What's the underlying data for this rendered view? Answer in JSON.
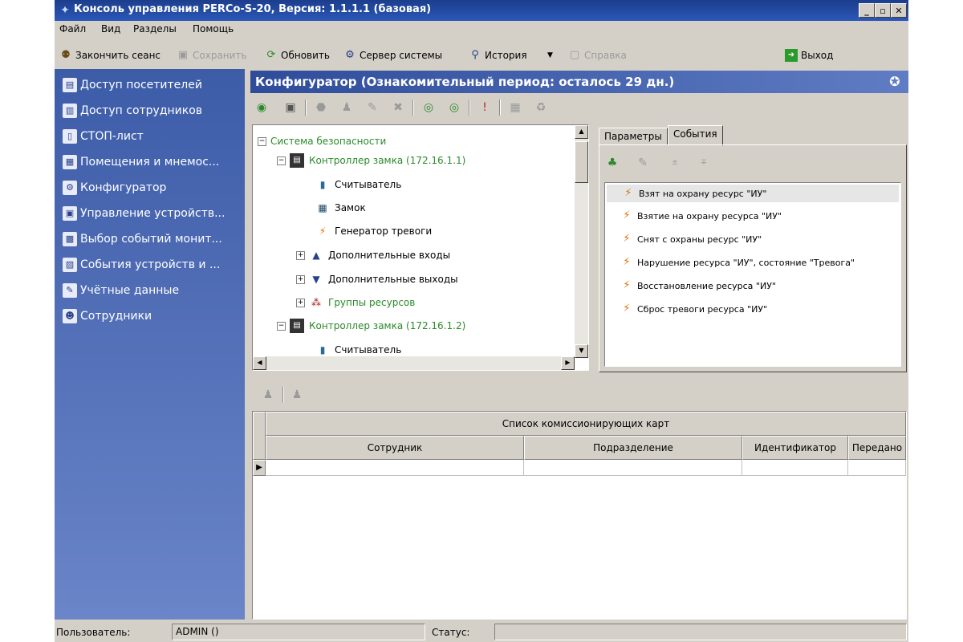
{
  "window": {
    "title": "Консоль управления PERCo-S-20, Версия: 1.1.1.1 (базовая)",
    "controls": {
      "minimize": "_",
      "maximize": "▫",
      "close": "✕"
    }
  },
  "menu": [
    "Файл",
    "Вид",
    "Разделы",
    "Помощь"
  ],
  "toolbar": {
    "end_session": "Закончить сеанс",
    "save": "Сохранить",
    "refresh": "Обновить",
    "system_server": "Сервер системы",
    "history": "История",
    "help": "Справка",
    "exit": "Выход"
  },
  "sidebar": {
    "items": [
      {
        "label": "Доступ посетителей",
        "icon": "visitor-access-icon"
      },
      {
        "label": "Доступ сотрудников",
        "icon": "lock-icon"
      },
      {
        "label": "СТОП-лист",
        "icon": "document-icon"
      },
      {
        "label": "Помещения и мнемос...",
        "icon": "rooms-icon"
      },
      {
        "label": "Конфигуратор",
        "icon": "gear-icon"
      },
      {
        "label": "Управление устройств...",
        "icon": "device-control-icon"
      },
      {
        "label": "Выбор событий монит...",
        "icon": "calendar-icon"
      },
      {
        "label": "События устройств и ...",
        "icon": "events-icon"
      },
      {
        "label": "Учётные данные",
        "icon": "pencil-icon"
      },
      {
        "label": "Сотрудники",
        "icon": "employees-icon"
      }
    ]
  },
  "panel": {
    "title": "Конфигуратор (Ознакомительный период: осталось 29 дн.)"
  },
  "tree": {
    "nodes": [
      {
        "label": "Система безопасности",
        "level": 0,
        "expander": "−",
        "icon": "",
        "green": true
      },
      {
        "label": "Контроллер замка (172.16.1.1)",
        "level": 1,
        "expander": "−",
        "icon": "controller-icon",
        "green": true
      },
      {
        "label": "Считыватель",
        "level": 2,
        "expander": "",
        "icon": "reader-icon",
        "green": false
      },
      {
        "label": "Замок",
        "level": 2,
        "expander": "",
        "icon": "lock-device-icon",
        "green": false
      },
      {
        "label": "Генератор тревоги",
        "level": 2,
        "expander": "",
        "icon": "alarm-icon",
        "green": false
      },
      {
        "label": "Дополнительные входы",
        "level": 2,
        "expander": "+",
        "icon": "inputs-icon",
        "green": false
      },
      {
        "label": "Дополнительные выходы",
        "level": 2,
        "expander": "+",
        "icon": "outputs-icon",
        "green": false
      },
      {
        "label": "Группы ресурсов",
        "level": 2,
        "expander": "+",
        "icon": "resource-groups-icon",
        "green": true
      },
      {
        "label": "Контроллер замка (172.16.1.2)",
        "level": 1,
        "expander": "−",
        "icon": "controller-icon",
        "green": true
      },
      {
        "label": "Считыватель",
        "level": 2,
        "expander": "",
        "icon": "reader-icon",
        "green": false
      }
    ]
  },
  "tabs": {
    "params": "Параметры",
    "events": "События"
  },
  "events": [
    "Взят на охрану ресурс \"ИУ\"",
    "Взятие на охрану ресурса \"ИУ\"",
    "Снят с охраны ресурс \"ИУ\"",
    "Нарушение ресурса \"ИУ\", состояние \"Тревога\"",
    "Восстановление ресурса \"ИУ\"",
    "Сброс тревоги ресурса \"ИУ\""
  ],
  "grid": {
    "group_header": "Список комиссионирующих карт",
    "columns": [
      "Сотрудник",
      "Подразделение",
      "Идентификатор",
      "Передано"
    ],
    "row_indicator": "▶"
  },
  "status": {
    "user_label": "Пользователь:",
    "user_value": "ADMIN ()",
    "status_label": "Статус:",
    "status_value": ""
  },
  "colors": {
    "title_bar": "#1c3d8c",
    "sidebar": "#3d5ca8",
    "tree_green": "#2a8a2a",
    "alarm_icon": "#e07000"
  }
}
